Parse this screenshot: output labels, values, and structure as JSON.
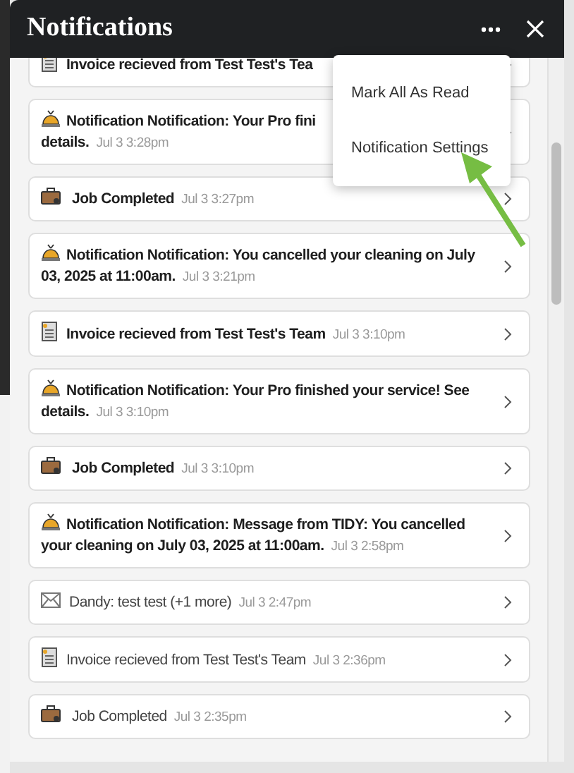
{
  "panel": {
    "title": "Notifications"
  },
  "menu": {
    "items": [
      {
        "label": "Mark All As Read"
      },
      {
        "label": "Notification Settings"
      }
    ]
  },
  "notifications": [
    {
      "kind": "invoice",
      "unread": true,
      "text": "Invoice recieved from Test Test's Tea"
    },
    {
      "kind": "bell",
      "unread": true,
      "text": "Notification Notification: Your Pro fini\ndetails.",
      "time": "Jul 3 3:28pm"
    },
    {
      "kind": "job",
      "unread": true,
      "text": "Job Completed",
      "time": "Jul 3 3:27pm"
    },
    {
      "kind": "bell",
      "unread": true,
      "text": "Notification Notification: You cancelled your cleaning on July 03, 2025 at 11:00am.",
      "time": "Jul 3 3:21pm"
    },
    {
      "kind": "invoice",
      "unread": true,
      "text": "Invoice recieved from Test Test's Team",
      "time": "Jul 3 3:10pm"
    },
    {
      "kind": "bell",
      "unread": true,
      "text": "Notification Notification: Your Pro finished your service! See details.",
      "time": "Jul 3 3:10pm"
    },
    {
      "kind": "job",
      "unread": true,
      "text": "Job Completed",
      "time": "Jul 3 3:10pm"
    },
    {
      "kind": "bell",
      "unread": true,
      "text": "Notification Notification: Message from TIDY: You cancelled your cleaning on July 03, 2025 at 11:00am.",
      "time": "Jul 3 2:58pm"
    },
    {
      "kind": "mail",
      "unread": false,
      "text": "Dandy: test test (+1 more)",
      "time": "Jul 3 2:47pm"
    },
    {
      "kind": "invoice",
      "unread": false,
      "text": "Invoice recieved from Test Test's Team",
      "time": "Jul 3 2:36pm"
    },
    {
      "kind": "job",
      "unread": false,
      "text": "Job Completed",
      "time": "Jul 3 2:35pm"
    }
  ]
}
